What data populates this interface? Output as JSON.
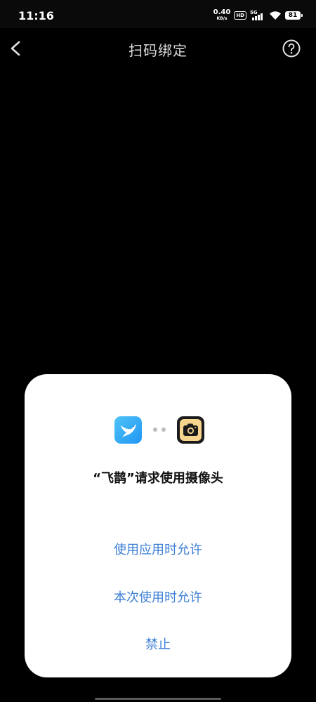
{
  "status_bar": {
    "time": "11:16",
    "net_speed_value": "0.40",
    "net_speed_unit": "KB/s",
    "hd_label": "HD",
    "network_label": "5G",
    "battery": "81"
  },
  "app_bar": {
    "title": "扫码绑定",
    "back_icon": "chevron-left-icon",
    "help_icon": "question-circle-icon"
  },
  "dialog": {
    "title": "“飞鹊”请求使用摄像头",
    "app_icon": "bird-icon",
    "app_icon_color": "#2196F3",
    "camera_icon": "camera-icon",
    "camera_icon_color": "#F8D58E",
    "option_color": "#3D7FD6",
    "options": [
      "使用应用时允许",
      "本次使用时允许",
      "禁止"
    ]
  }
}
